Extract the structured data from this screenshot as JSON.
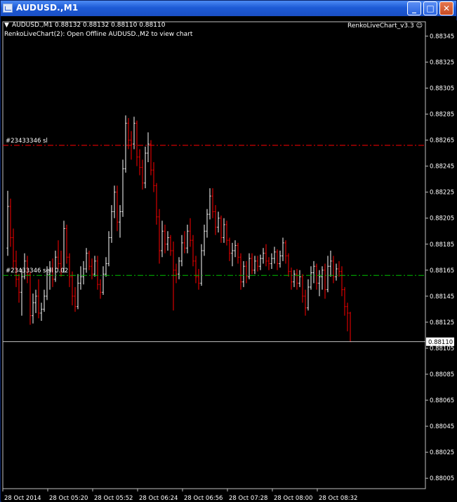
{
  "window": {
    "title": "AUDUSD.,M1",
    "controls": {
      "minimize": "_",
      "maximize": "□",
      "close": "✕"
    }
  },
  "chart_header": {
    "symbol_line": "AUDUSD.,M1  0.88132 0.88132 0.88110 0.88110",
    "indicator_line": "RenkoLiveChart(2): Open Offline AUDUSD.,M2 to view chart",
    "ea_label": "RenkoLiveChart_v3.3 ☺"
  },
  "colors": {
    "background": "#000000",
    "bull_bar": "#ffffff",
    "bear_bar": "#ff0000",
    "sl_line": "#ff0000",
    "order_line": "#00c000",
    "bid_line": "#c0c0c0",
    "price_tag_bg": "#ffffff",
    "price_tag_text": "#000000",
    "text": "#ffffff"
  },
  "chart_data": {
    "type": "bar",
    "subtype": "ohlc",
    "x_axis_labels": [
      "28 Oct 2014",
      "28 Oct 05:20",
      "28 Oct 05:52",
      "28 Oct 06:24",
      "28 Oct 06:56",
      "28 Oct 07:28",
      "28 Oct 08:00",
      "28 Oct 08:32"
    ],
    "y_axis_labels": [
      "0.88345",
      "0.88325",
      "0.88305",
      "0.88285",
      "0.88265",
      "0.88245",
      "0.88225",
      "0.88205",
      "0.88185",
      "0.88165",
      "0.88145",
      "0.88125",
      "0.88105",
      "0.88085",
      "0.88065",
      "0.88045",
      "0.88025",
      "0.88005"
    ],
    "ylim": [
      0.87997,
      0.88356
    ],
    "x_minutes_start": 0,
    "x_minutes_per_bar": 1,
    "current_price": "0.88110",
    "levels": [
      {
        "name": "stop-loss",
        "label": "#23433346 sl",
        "price": 0.88261
      },
      {
        "name": "order",
        "label": "#23433346 sell 0.02",
        "price": 0.88161
      }
    ],
    "bars": [
      [
        0.88182,
        0.88226,
        0.88176,
        0.88214
      ],
      [
        0.88214,
        0.8822,
        0.88183,
        0.8819
      ],
      [
        0.8819,
        0.88197,
        0.88165,
        0.88172
      ],
      [
        0.88172,
        0.8818,
        0.88152,
        0.88158
      ],
      [
        0.88158,
        0.88162,
        0.8814,
        0.88148
      ],
      [
        0.88148,
        0.88166,
        0.8813,
        0.8816
      ],
      [
        0.8816,
        0.88178,
        0.88158,
        0.88172
      ],
      [
        0.88172,
        0.88176,
        0.88155,
        0.88162
      ],
      [
        0.88162,
        0.88164,
        0.88123,
        0.8813
      ],
      [
        0.8813,
        0.88147,
        0.88124,
        0.8814
      ],
      [
        0.8814,
        0.8815,
        0.88132,
        0.88145
      ],
      [
        0.88145,
        0.88158,
        0.88128,
        0.88132
      ],
      [
        0.88132,
        0.8814,
        0.88126,
        0.88135
      ],
      [
        0.88135,
        0.8815,
        0.88133,
        0.88145
      ],
      [
        0.88145,
        0.88168,
        0.88142,
        0.88162
      ],
      [
        0.88162,
        0.88172,
        0.8815,
        0.88165
      ],
      [
        0.88165,
        0.88174,
        0.88152,
        0.88158
      ],
      [
        0.88158,
        0.8818,
        0.88156,
        0.88175
      ],
      [
        0.88175,
        0.88188,
        0.88166,
        0.8817
      ],
      [
        0.8817,
        0.8818,
        0.8816,
        0.88165
      ],
      [
        0.88165,
        0.88203,
        0.88163,
        0.88197
      ],
      [
        0.88197,
        0.882,
        0.8817,
        0.88175
      ],
      [
        0.88175,
        0.88178,
        0.88152,
        0.8816
      ],
      [
        0.8816,
        0.88164,
        0.88138,
        0.88145
      ],
      [
        0.88145,
        0.88152,
        0.88133,
        0.88137
      ],
      [
        0.88137,
        0.88162,
        0.88135,
        0.88155
      ],
      [
        0.88155,
        0.88168,
        0.8815,
        0.8816
      ],
      [
        0.8816,
        0.88172,
        0.88154,
        0.88166
      ],
      [
        0.88166,
        0.88182,
        0.88163,
        0.88178
      ],
      [
        0.88178,
        0.8818,
        0.88165,
        0.88168
      ],
      [
        0.88168,
        0.88174,
        0.88158,
        0.88162
      ],
      [
        0.88162,
        0.88176,
        0.8816,
        0.88172
      ],
      [
        0.88172,
        0.88176,
        0.8815,
        0.88154
      ],
      [
        0.88154,
        0.88158,
        0.88143,
        0.88148
      ],
      [
        0.88148,
        0.88168,
        0.88146,
        0.88162
      ],
      [
        0.88162,
        0.88175,
        0.8816,
        0.8817
      ],
      [
        0.8817,
        0.88195,
        0.88168,
        0.8819
      ],
      [
        0.8819,
        0.88215,
        0.88186,
        0.8821
      ],
      [
        0.8821,
        0.8823,
        0.88205,
        0.88225
      ],
      [
        0.88225,
        0.8823,
        0.88195,
        0.88202
      ],
      [
        0.88202,
        0.88215,
        0.8819,
        0.8821
      ],
      [
        0.8821,
        0.8825,
        0.88206,
        0.88243
      ],
      [
        0.88243,
        0.88284,
        0.8824,
        0.88278
      ],
      [
        0.88278,
        0.88282,
        0.88258,
        0.88265
      ],
      [
        0.88265,
        0.88272,
        0.8825,
        0.88262
      ],
      [
        0.88262,
        0.88283,
        0.88258,
        0.88278
      ],
      [
        0.88278,
        0.8828,
        0.88245,
        0.88252
      ],
      [
        0.88252,
        0.88258,
        0.88238,
        0.88244
      ],
      [
        0.88244,
        0.8825,
        0.88227,
        0.88232
      ],
      [
        0.88232,
        0.8826,
        0.88228,
        0.88255
      ],
      [
        0.88255,
        0.88271,
        0.88248,
        0.88262
      ],
      [
        0.88262,
        0.88265,
        0.88238,
        0.88242
      ],
      [
        0.88242,
        0.88248,
        0.88225,
        0.8823
      ],
      [
        0.8823,
        0.88232,
        0.882,
        0.88206
      ],
      [
        0.88206,
        0.88212,
        0.8817,
        0.8818
      ],
      [
        0.8818,
        0.88203,
        0.88175,
        0.88195
      ],
      [
        0.88195,
        0.882,
        0.88178,
        0.88185
      ],
      [
        0.88185,
        0.88195,
        0.8818,
        0.8819
      ],
      [
        0.8819,
        0.88192,
        0.88176,
        0.8818
      ],
      [
        0.8818,
        0.88187,
        0.88134,
        0.88165
      ],
      [
        0.88165,
        0.8817,
        0.88155,
        0.88162
      ],
      [
        0.88162,
        0.88175,
        0.88158,
        0.88172
      ],
      [
        0.88172,
        0.88192,
        0.88168,
        0.88186
      ],
      [
        0.88186,
        0.88195,
        0.88178,
        0.88182
      ],
      [
        0.88182,
        0.882,
        0.88178,
        0.88195
      ],
      [
        0.88195,
        0.88205,
        0.88183,
        0.88188
      ],
      [
        0.88188,
        0.88192,
        0.88168,
        0.88172
      ],
      [
        0.88172,
        0.88176,
        0.88155,
        0.8816
      ],
      [
        0.8816,
        0.88166,
        0.8815,
        0.88155
      ],
      [
        0.88155,
        0.88185,
        0.88153,
        0.8818
      ],
      [
        0.8818,
        0.882,
        0.88176,
        0.88195
      ],
      [
        0.88195,
        0.88212,
        0.8819,
        0.88208
      ],
      [
        0.88208,
        0.88228,
        0.88204,
        0.88222
      ],
      [
        0.88222,
        0.88228,
        0.88205,
        0.8821
      ],
      [
        0.8821,
        0.88215,
        0.88192,
        0.88198
      ],
      [
        0.88198,
        0.8821,
        0.88194,
        0.88205
      ],
      [
        0.88205,
        0.88207,
        0.88186,
        0.8819
      ],
      [
        0.8819,
        0.88205,
        0.88186,
        0.882
      ],
      [
        0.882,
        0.88203,
        0.88184,
        0.88188
      ],
      [
        0.88188,
        0.8819,
        0.88172,
        0.88178
      ],
      [
        0.88178,
        0.88186,
        0.88168,
        0.8818
      ],
      [
        0.8818,
        0.88188,
        0.88175,
        0.88184
      ],
      [
        0.88184,
        0.88186,
        0.8817,
        0.88175
      ],
      [
        0.88175,
        0.88178,
        0.8815,
        0.88156
      ],
      [
        0.88156,
        0.88172,
        0.88152,
        0.88168
      ],
      [
        0.88168,
        0.88172,
        0.88155,
        0.8816
      ],
      [
        0.8816,
        0.88178,
        0.88158,
        0.88174
      ],
      [
        0.88174,
        0.88178,
        0.88162,
        0.88165
      ],
      [
        0.88165,
        0.88176,
        0.88162,
        0.88172
      ],
      [
        0.88172,
        0.88176,
        0.88164,
        0.88168
      ],
      [
        0.88168,
        0.88177,
        0.88165,
        0.88174
      ],
      [
        0.88174,
        0.88182,
        0.8817,
        0.88178
      ],
      [
        0.88178,
        0.88185,
        0.88168,
        0.88172
      ],
      [
        0.88172,
        0.88175,
        0.88165,
        0.8817
      ],
      [
        0.8817,
        0.88178,
        0.88166,
        0.88174
      ],
      [
        0.88174,
        0.88183,
        0.8817,
        0.88179
      ],
      [
        0.88179,
        0.88181,
        0.88165,
        0.8817
      ],
      [
        0.8817,
        0.8818,
        0.88167,
        0.88176
      ],
      [
        0.88176,
        0.8819,
        0.88172,
        0.88186
      ],
      [
        0.88186,
        0.88188,
        0.8817,
        0.88176
      ],
      [
        0.88176,
        0.88178,
        0.8816,
        0.88164
      ],
      [
        0.88164,
        0.88167,
        0.8815,
        0.88156
      ],
      [
        0.88156,
        0.88165,
        0.88152,
        0.88162
      ],
      [
        0.88162,
        0.88166,
        0.8815,
        0.88155
      ],
      [
        0.88155,
        0.88165,
        0.88152,
        0.8816
      ],
      [
        0.8816,
        0.88162,
        0.8814,
        0.88145
      ],
      [
        0.88145,
        0.8815,
        0.8813,
        0.88136
      ],
      [
        0.88136,
        0.88158,
        0.88134,
        0.88152
      ],
      [
        0.88152,
        0.88168,
        0.8815,
        0.88163
      ],
      [
        0.88163,
        0.88172,
        0.88155,
        0.88168
      ],
      [
        0.88168,
        0.8817,
        0.8815,
        0.88155
      ],
      [
        0.88155,
        0.88165,
        0.88145,
        0.8816
      ],
      [
        0.8816,
        0.88168,
        0.8815,
        0.88165
      ],
      [
        0.88165,
        0.8817,
        0.88143,
        0.8815
      ],
      [
        0.8815,
        0.88176,
        0.88148,
        0.88168
      ],
      [
        0.88168,
        0.8818,
        0.8816,
        0.88172
      ],
      [
        0.88172,
        0.88176,
        0.88155,
        0.8816
      ],
      [
        0.8816,
        0.8817,
        0.88157,
        0.88166
      ],
      [
        0.88166,
        0.88172,
        0.8816,
        0.88164
      ],
      [
        0.88164,
        0.88168,
        0.88145,
        0.8815
      ],
      [
        0.8815,
        0.88152,
        0.8813,
        0.88137
      ],
      [
        0.88137,
        0.8814,
        0.88118,
        0.88132
      ],
      [
        0.88132,
        0.88133,
        0.8811,
        0.8811
      ]
    ]
  }
}
